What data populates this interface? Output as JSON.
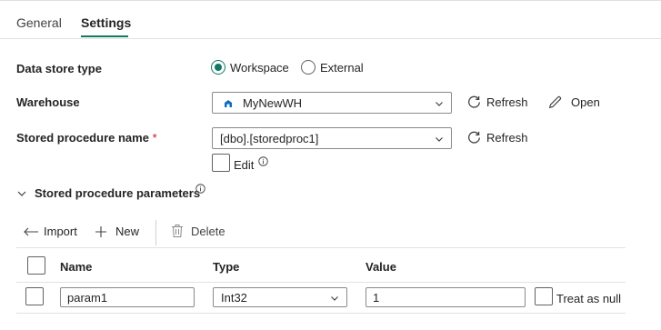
{
  "tabs": {
    "general": "General",
    "settings": "Settings"
  },
  "data_store_type": {
    "label": "Data store type",
    "options": [
      "Workspace",
      "External"
    ],
    "selected": "Workspace"
  },
  "warehouse": {
    "label": "Warehouse",
    "value": "MyNewWH",
    "refresh": "Refresh",
    "open": "Open"
  },
  "stored_procedure": {
    "label": "Stored procedure name",
    "required_mark": "*",
    "value": "[dbo].[storedproc1]",
    "refresh": "Refresh",
    "edit_label": "Edit"
  },
  "parameters": {
    "section_label": "Stored procedure parameters",
    "toolbar": {
      "import": "Import",
      "new": "New",
      "delete": "Delete"
    },
    "columns": [
      "Name",
      "Type",
      "Value"
    ],
    "rows": [
      {
        "name": "param1",
        "type": "Int32",
        "value": "1",
        "treat_as_null": "Treat as null"
      }
    ]
  },
  "colors": {
    "accent": "#117865",
    "required": "#c50f1f",
    "border": "#8a8a8a"
  }
}
